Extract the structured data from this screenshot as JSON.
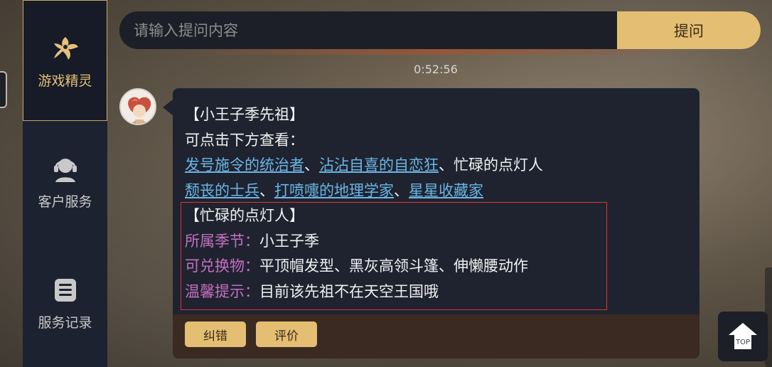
{
  "sidebar": {
    "items": [
      {
        "label": "游戏精灵",
        "icon": "fairy-icon",
        "active": true
      },
      {
        "label": "客户服务",
        "icon": "headset-agent-icon",
        "active": false
      },
      {
        "label": "服务记录",
        "icon": "records-list-icon",
        "active": false
      }
    ]
  },
  "search": {
    "placeholder": "请输入提问内容",
    "value": "",
    "button_label": "提问"
  },
  "timestamp": "0:52:56",
  "message": {
    "title": "【小王子季先祖】",
    "prompt": "可点击下方查看：",
    "links_row1": {
      "link1": "发号施令的统治者",
      "sep1": "、",
      "link2": "沾沾自喜的自恋狂",
      "sep2": "、",
      "plain": "忙碌的点灯人"
    },
    "links_row2": {
      "link1": "颓丧的士兵",
      "sep1": "、",
      "link2": "打喷嚏的地理学家",
      "sep2": "、",
      "link3": "星星收藏家"
    },
    "detail": {
      "heading": "【忙碌的点灯人】",
      "season_label": "所属季节：",
      "season_value": "小王子季",
      "exchange_label": "可兑换物：",
      "exchange_value": "平顶帽发型、黑灰高领斗篷、伸懒腰动作",
      "tip_label": "温馨提示：",
      "tip_value": "目前该先祖不在天空王国哦"
    },
    "footer": {
      "correct_label": "纠错",
      "rate_label": "评价"
    }
  },
  "top_button": {
    "label": "TOP",
    "icon": "house-up-icon"
  },
  "colors": {
    "accent_gold": "#e3be73",
    "link_blue": "#6ab6e4",
    "label_pink": "#c770c0",
    "highlight_red": "#e03333",
    "panel_dark": "#1f2330"
  }
}
